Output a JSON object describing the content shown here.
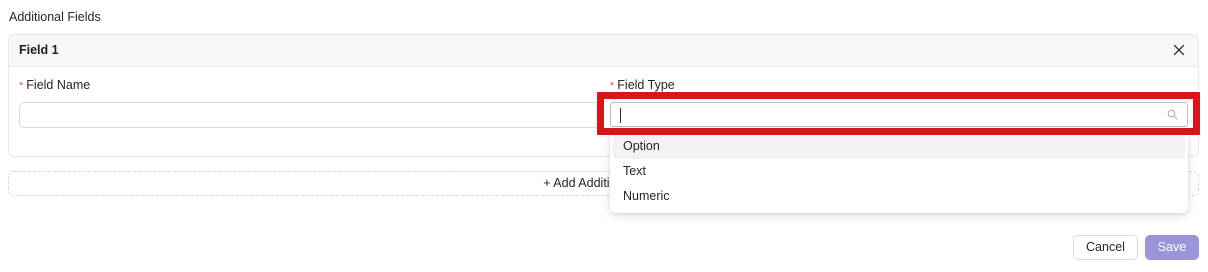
{
  "section": {
    "title": "Additional Fields"
  },
  "field_card": {
    "title": "Field 1",
    "field_name": {
      "label": "Field Name",
      "value": ""
    },
    "field_type": {
      "label": "Field Type",
      "search_value": ""
    }
  },
  "field_type_dropdown": {
    "options": [
      "Option",
      "Text",
      "Numeric"
    ],
    "active_option": "Option"
  },
  "add_button": {
    "label": "+ Add Additional Field"
  },
  "footer": {
    "cancel_label": "Cancel",
    "save_label": "Save"
  },
  "colors": {
    "required": "#ff4d4f",
    "highlight": "#d7161c",
    "save_button": "#9a95d9"
  }
}
